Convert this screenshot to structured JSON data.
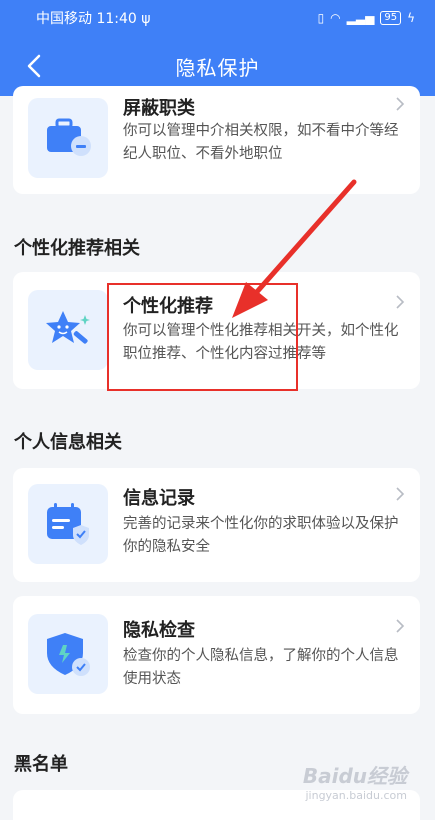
{
  "status_bar": {
    "carrier": "中国移动",
    "time": "11:40",
    "battery": "95"
  },
  "nav": {
    "title": "隐私保护"
  },
  "cards": [
    {
      "title": "屏蔽职类",
      "desc": "你可以管理中介相关权限，如不看中介等经纪人职位、不看外地职位",
      "icon": "briefcase-block-icon"
    },
    {
      "title": "个性化推荐",
      "desc": "你可以管理个性化推荐相关开关，如个性化职位推荐、个性化内容过推荐等",
      "icon": "magic-wand-star-icon"
    },
    {
      "title": "信息记录",
      "desc": "完善的记录来个性化你的求职体验以及保护你的隐私安全",
      "icon": "calendar-shield-icon"
    },
    {
      "title": "隐私检查",
      "desc": "检查你的个人隐私信息，了解你的个人信息使用状态",
      "icon": "shield-check-icon"
    }
  ],
  "sections": {
    "personalized": "个性化推荐相关",
    "personal_info": "个人信息相关",
    "blacklist": "黑名单"
  },
  "watermark": {
    "brand": "Baidu经验",
    "url": "jingyan.baidu.com"
  },
  "colors": {
    "primary": "#3f80f7",
    "annotation": "#e8302a"
  }
}
